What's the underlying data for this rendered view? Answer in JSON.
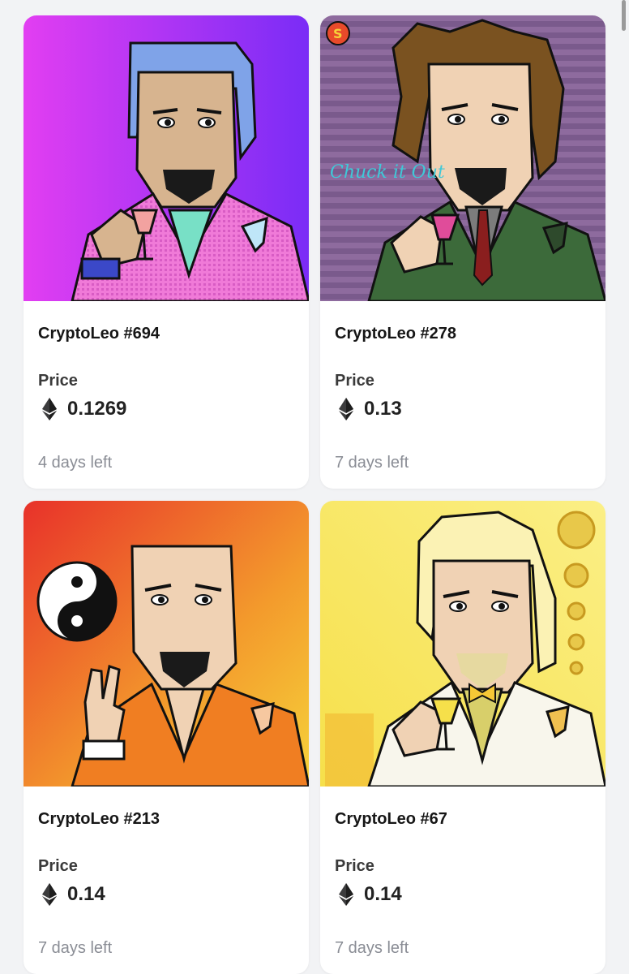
{
  "listings": [
    {
      "title": "CryptoLeo #694",
      "price_label": "Price",
      "price": "0.1269",
      "currency_icon": "ethereum-icon",
      "time_left": "4 days left",
      "background_colors": [
        "#e23ef2",
        "#7a2cf6"
      ]
    },
    {
      "title": "CryptoLeo #278",
      "price_label": "Price",
      "price": "0.13",
      "currency_icon": "ethereum-icon",
      "time_left": "7 days left",
      "background_colors": [
        "#8e6b9e",
        "#5a4a78"
      ]
    },
    {
      "title": "CryptoLeo #213",
      "price_label": "Price",
      "price": "0.14",
      "currency_icon": "ethereum-icon",
      "time_left": "7 days left",
      "background_colors": [
        "#e8312a",
        "#f6d23a"
      ]
    },
    {
      "title": "CryptoLeo #67",
      "price_label": "Price",
      "price": "0.14",
      "currency_icon": "ethereum-icon",
      "time_left": "7 days left",
      "background_colors": [
        "#f6e04a",
        "#fbef86"
      ]
    }
  ]
}
